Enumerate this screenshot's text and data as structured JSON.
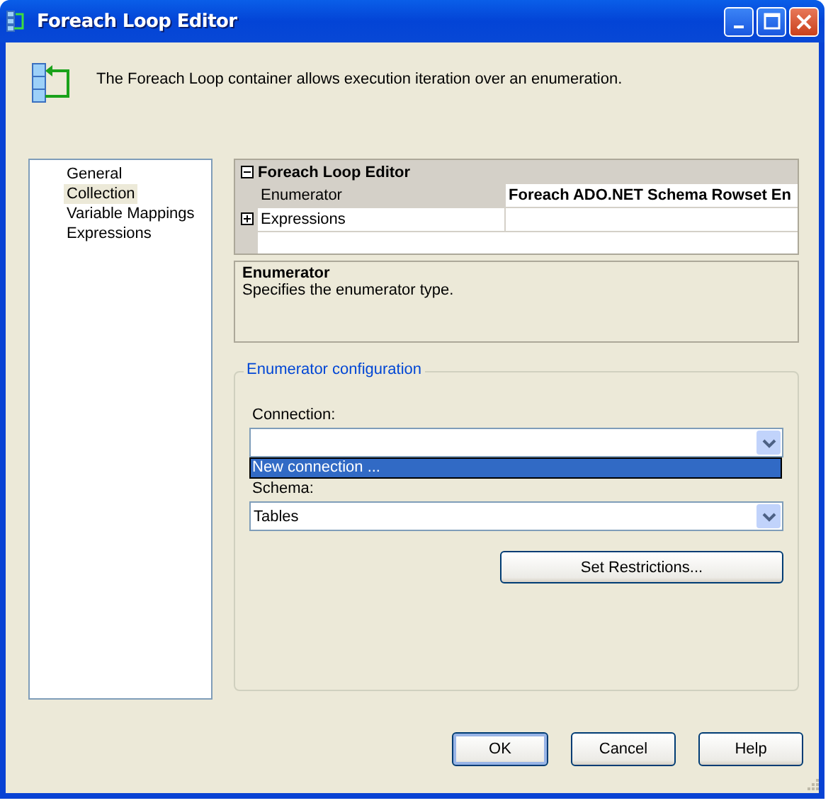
{
  "window": {
    "title": "Foreach Loop Editor",
    "description": "The Foreach Loop container allows execution iteration over an enumeration."
  },
  "nav": [
    {
      "label": "General",
      "selected": false
    },
    {
      "label": "Collection",
      "selected": true
    },
    {
      "label": "Variable Mappings",
      "selected": false
    },
    {
      "label": "Expressions",
      "selected": false
    }
  ],
  "property_grid": {
    "category": {
      "label": "Foreach Loop Editor",
      "expanded": true
    },
    "rows": [
      {
        "name": "Enumerator",
        "value": "Foreach ADO.NET Schema Rowset En",
        "kind": "property",
        "selected": true
      },
      {
        "name": "Expressions",
        "kind": "expandable",
        "expanded": false,
        "selected": false
      }
    ]
  },
  "help": {
    "title": "Enumerator",
    "text": "Specifies the enumerator type."
  },
  "group": {
    "title": "Enumerator configuration",
    "fields": [
      {
        "label": "Connection:"
      },
      {
        "label": "Schema:",
        "value": "Tables"
      }
    ],
    "dropdown_items": [
      {
        "label": "New connection ...",
        "selected": true
      }
    ],
    "button": "Set Restrictions..."
  },
  "buttons": [
    {
      "label": "OK",
      "default": true
    },
    {
      "label": "Cancel",
      "default": false
    },
    {
      "label": "Help",
      "default": false
    }
  ]
}
